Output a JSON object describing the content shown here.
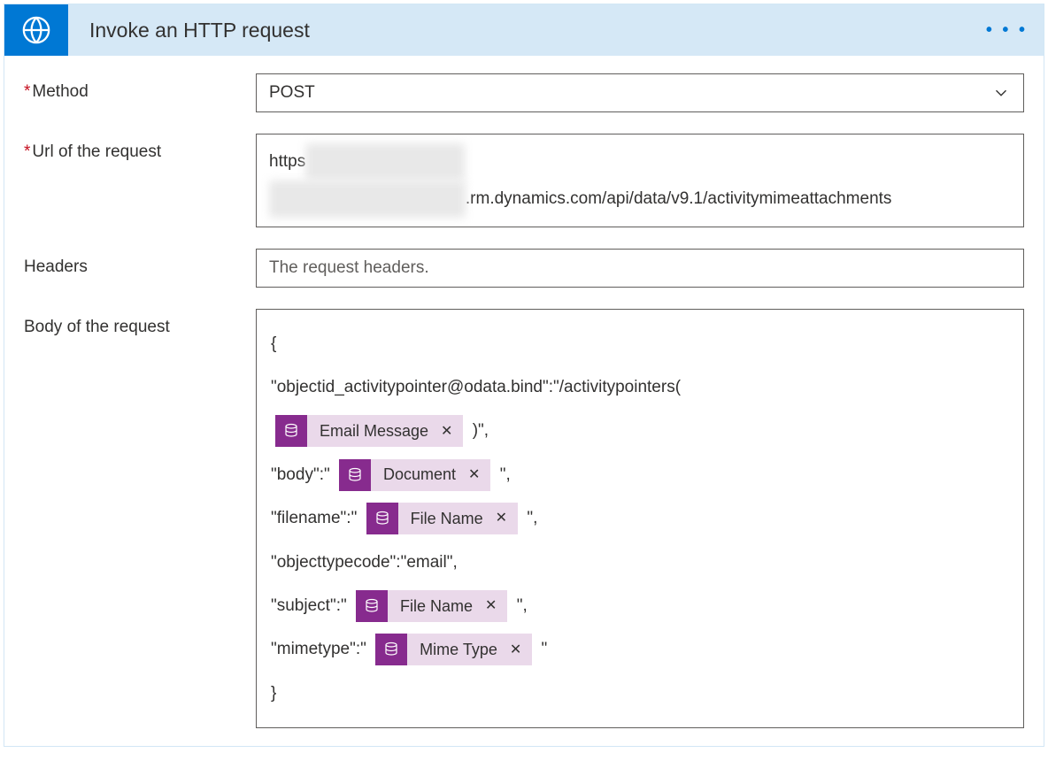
{
  "header": {
    "title": "Invoke an HTTP request"
  },
  "fields": {
    "method": {
      "label": "Method",
      "value": "POST"
    },
    "url": {
      "label": "Url of the request",
      "prefix": "https",
      "suffix": ".rm.dynamics.com/api/data/v9.1/activitymimeattachments"
    },
    "headers": {
      "label": "Headers",
      "placeholder": "The request headers."
    },
    "body": {
      "label": "Body of the request",
      "open_brace": "{",
      "close_brace": "}",
      "lines": {
        "l1a": "\"objectid_activitypointer@odata.bind\":\"/activitypointers(",
        "l1b": ")\",",
        "l2a": "\"body\":\"",
        "l2b": "\",",
        "l3a": "\"filename\":\"",
        "l3b": "\",",
        "l4": "\"objecttypecode\":\"email\",",
        "l5a": "\"subject\":\"",
        "l5b": "\",",
        "l6a": "\"mimetype\":\"",
        "l6b": "\""
      },
      "tokens": {
        "email_message": "Email Message",
        "document": "Document",
        "file_name": "File Name",
        "mime_type": "Mime Type"
      }
    }
  }
}
